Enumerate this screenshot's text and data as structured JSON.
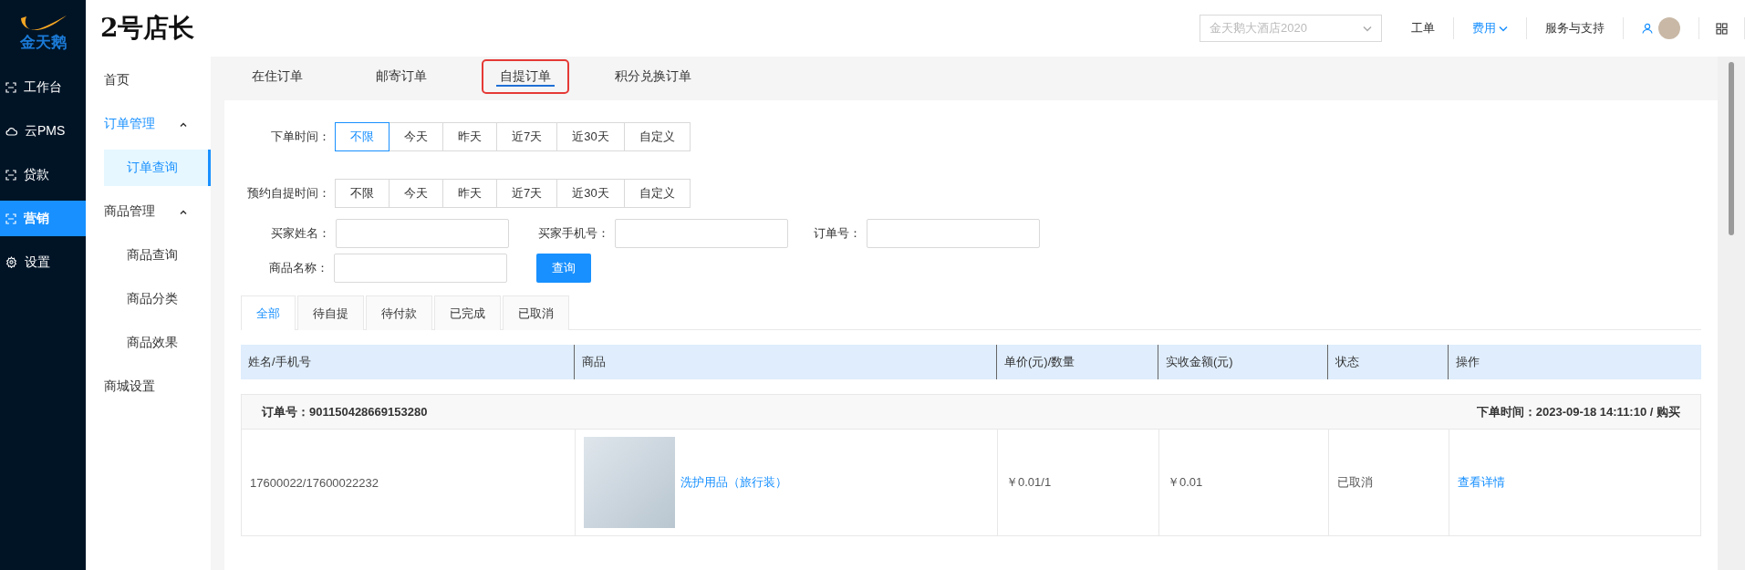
{
  "logo": {
    "text": "金天鹅"
  },
  "app_title": "2号店长",
  "nav": [
    {
      "label": "工作台",
      "selected": false
    },
    {
      "label": "云PMS",
      "selected": false
    },
    {
      "label": "贷款",
      "selected": false
    },
    {
      "label": "营销",
      "selected": true
    },
    {
      "label": "设置",
      "selected": false
    }
  ],
  "topbar": {
    "store_select": {
      "value": "金天鹅大酒店2020"
    },
    "links": [
      {
        "label": "工单",
        "dropdown": false,
        "active": false
      },
      {
        "label": "费用",
        "dropdown": true,
        "active": true
      },
      {
        "label": "服务与支持",
        "dropdown": false,
        "active": false
      }
    ]
  },
  "submenu": [
    {
      "label": "首页",
      "selected": false
    },
    {
      "label": "订单管理",
      "expanded": true,
      "active": true,
      "children": [
        {
          "label": "订单查询",
          "selected": true
        }
      ]
    },
    {
      "label": "商品管理",
      "expanded": true,
      "active": false,
      "children": [
        {
          "label": "商品查询",
          "selected": false
        },
        {
          "label": "商品分类",
          "selected": false
        },
        {
          "label": "商品效果",
          "selected": false
        }
      ]
    },
    {
      "label": "商城设置",
      "selected": false
    }
  ],
  "order_tabs": [
    {
      "label": "在住订单",
      "selected": false,
      "highlighted": false
    },
    {
      "label": "邮寄订单",
      "selected": false,
      "highlighted": false
    },
    {
      "label": "自提订单",
      "selected": true,
      "highlighted": true
    },
    {
      "label": "积分兑换订单",
      "selected": false,
      "highlighted": false
    }
  ],
  "filters": [
    {
      "label": "下单时间：",
      "options": [
        {
          "label": "不限",
          "selected": true
        },
        {
          "label": "今天",
          "selected": false
        },
        {
          "label": "昨天",
          "selected": false
        },
        {
          "label": "近7天",
          "selected": false
        },
        {
          "label": "近30天",
          "selected": false
        },
        {
          "label": "自定义",
          "selected": false
        }
      ]
    },
    {
      "label": "预约自提时间：",
      "options": [
        {
          "label": "不限",
          "selected": false
        },
        {
          "label": "今天",
          "selected": false
        },
        {
          "label": "昨天",
          "selected": false
        },
        {
          "label": "近7天",
          "selected": false
        },
        {
          "label": "近30天",
          "selected": false
        },
        {
          "label": "自定义",
          "selected": false
        }
      ]
    }
  ],
  "fields": [
    {
      "label": "买家姓名："
    },
    {
      "label": "买家手机号："
    },
    {
      "label": "订单号："
    },
    {
      "label": "商品名称："
    }
  ],
  "search_button": "查询",
  "status_tabs": [
    {
      "label": "全部",
      "selected": true
    },
    {
      "label": "待自提",
      "selected": false
    },
    {
      "label": "待付款",
      "selected": false
    },
    {
      "label": "已完成",
      "selected": false
    },
    {
      "label": "已取消",
      "selected": false
    }
  ],
  "table": {
    "columns": [
      "姓名/手机号",
      "商品",
      "单价(元)/数量",
      "实收金额(元)",
      "状态",
      "操作"
    ],
    "orders": [
      {
        "order_no": "订单号：901150428669153280",
        "order_time": "下单时间：2023-09-18 14:11:10 / 购买",
        "buyer": "17600022/17600022232",
        "product": "洗护用品（旅行装）",
        "price_qty": "￥0.01/1",
        "paid": "￥0.01",
        "status": "已取消",
        "action": "查看详情"
      }
    ]
  }
}
